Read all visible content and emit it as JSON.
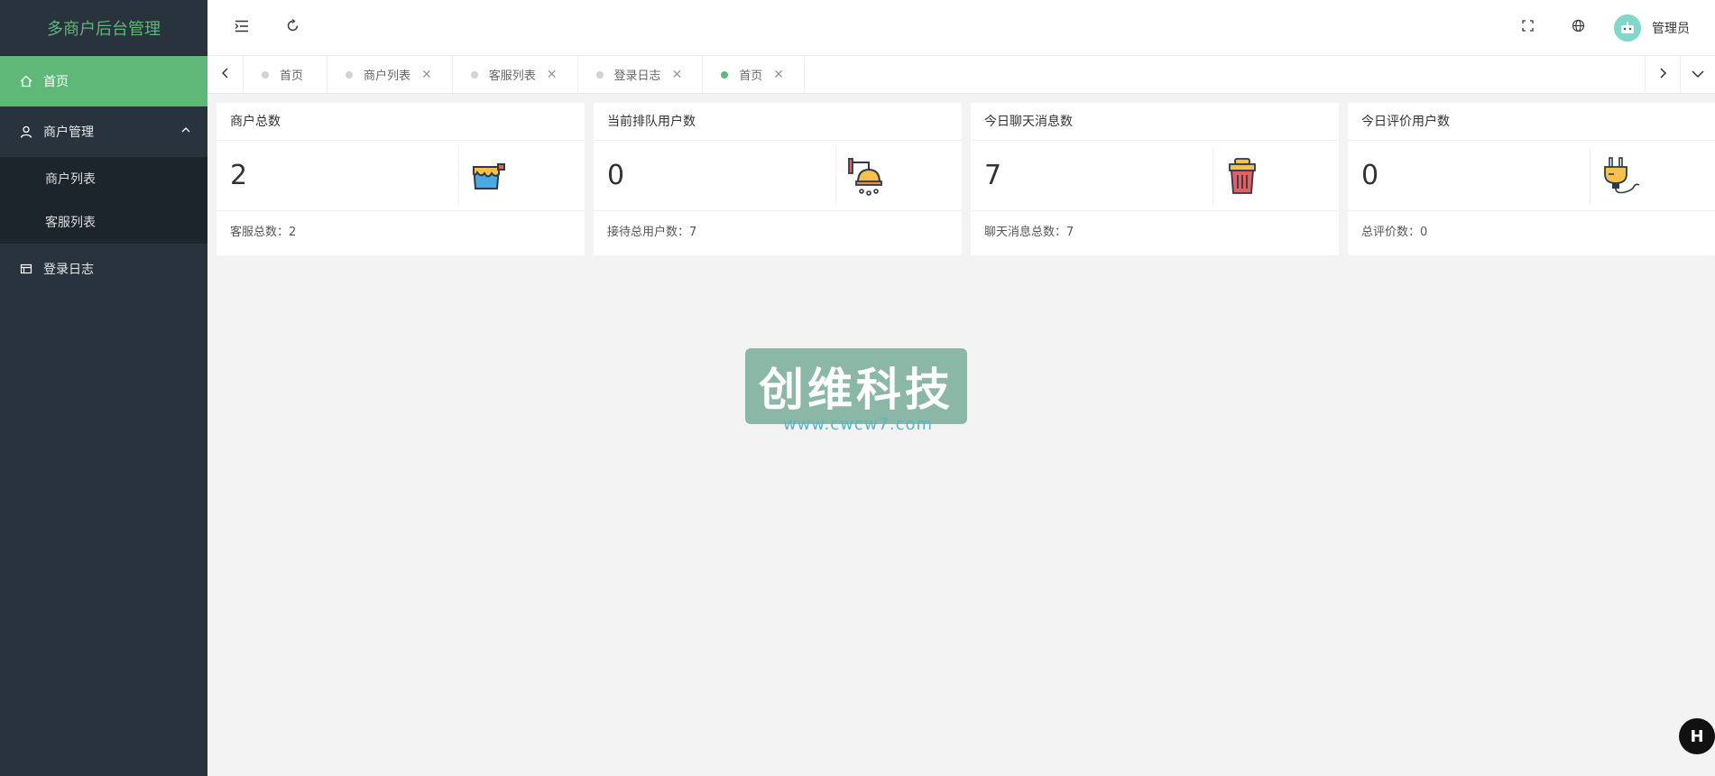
{
  "app": {
    "title": "多商户后台管理"
  },
  "sidebar": {
    "items": [
      {
        "label": "首页",
        "icon": "home-icon",
        "active": true
      },
      {
        "label": "商户管理",
        "icon": "user-icon",
        "expanded": true,
        "children": [
          {
            "label": "商户列表"
          },
          {
            "label": "客服列表"
          }
        ]
      },
      {
        "label": "登录日志",
        "icon": "log-icon"
      }
    ]
  },
  "header": {
    "icons": [
      "menu-fold-icon",
      "refresh-icon",
      "fullscreen-icon",
      "globe-icon"
    ],
    "user_name": "管理员"
  },
  "tabs": [
    {
      "label": "首页",
      "closable": false,
      "active": false
    },
    {
      "label": "商户列表",
      "closable": true,
      "active": false
    },
    {
      "label": "客服列表",
      "closable": true,
      "active": false
    },
    {
      "label": "登录日志",
      "closable": true,
      "active": false
    },
    {
      "label": "首页",
      "closable": true,
      "active": true
    }
  ],
  "cards": [
    {
      "title": "商户总数",
      "value": "2",
      "footer": "客服总数：2",
      "icon": "bucket-icon"
    },
    {
      "title": "当前排队用户数",
      "value": "0",
      "footer": "接待总用户数：7",
      "icon": "shower-icon"
    },
    {
      "title": "今日聊天消息数",
      "value": "7",
      "footer": "聊天消息总数：7",
      "icon": "trash-icon"
    },
    {
      "title": "今日评价用户数",
      "value": "0",
      "footer": "总评价数：0",
      "icon": "plug-icon"
    }
  ],
  "watermark": {
    "title": "创维科技",
    "url": "www.cwcw7.com"
  },
  "badge": {
    "label": "H"
  },
  "colors": {
    "accent": "#5fb878",
    "sidebar": "#28333e",
    "submenu": "#1c242c",
    "background": "#f3f3f3"
  }
}
